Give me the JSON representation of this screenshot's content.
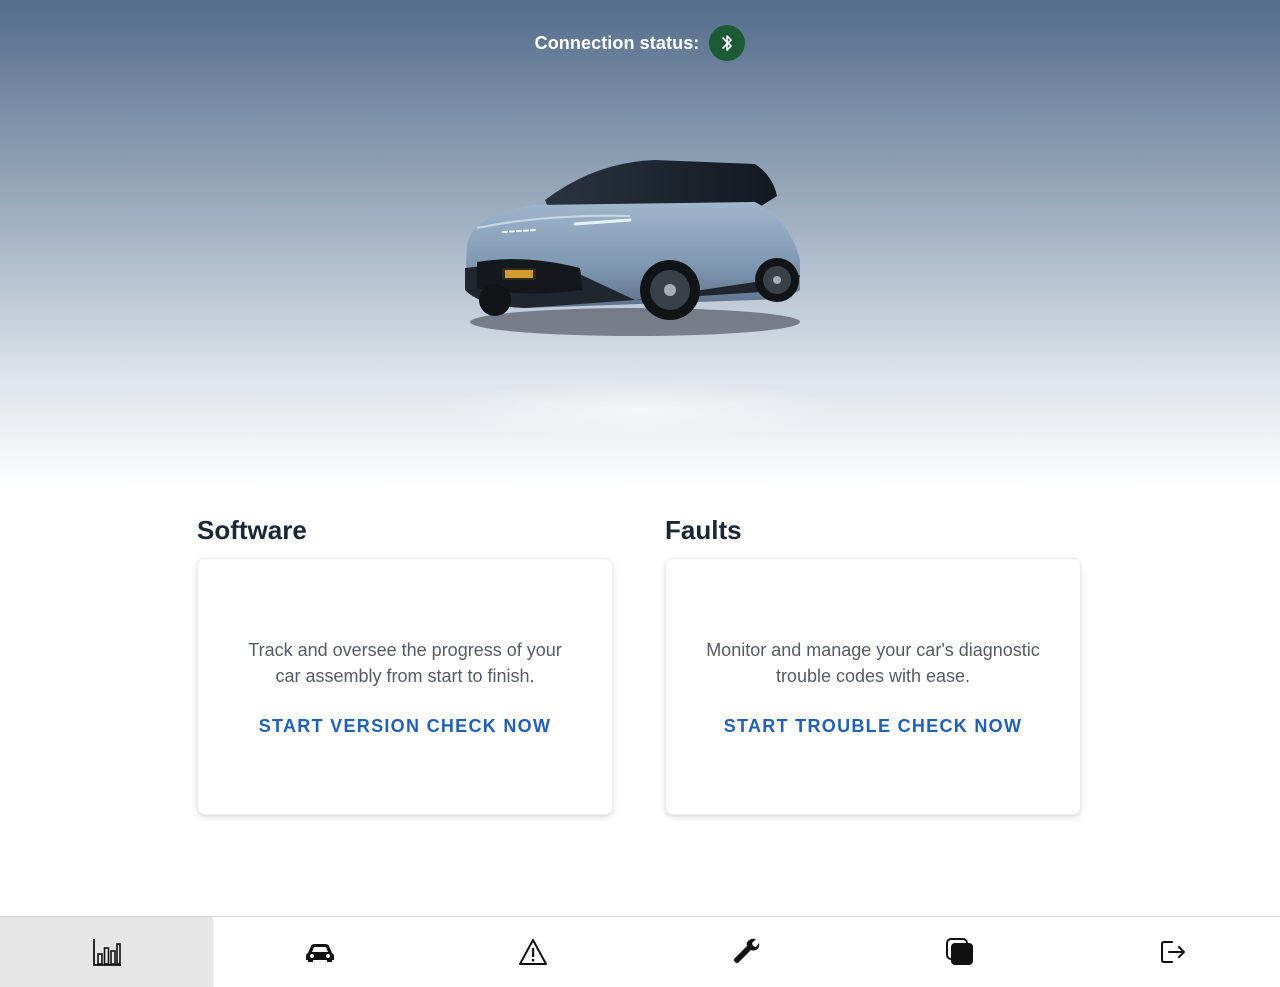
{
  "connection": {
    "label": "Connection status:",
    "state_icon": "bluetooth-icon",
    "color": "#1c5a36"
  },
  "hero": {
    "image": "vehicle-image"
  },
  "software": {
    "title": "Software",
    "description": "Track and oversee the progress of your car assembly from start to finish.",
    "action": "START VERSION CHECK NOW"
  },
  "faults": {
    "title": "Faults",
    "description": "Monitor and manage your car's diagnostic trouble codes with ease.",
    "action": "START TROUBLE CHECK NOW"
  },
  "nav": {
    "items": [
      {
        "icon": "bar-chart-icon",
        "active": true
      },
      {
        "icon": "car-icon",
        "active": false
      },
      {
        "icon": "warning-icon",
        "active": false
      },
      {
        "icon": "wrench-icon",
        "active": false
      },
      {
        "icon": "copy-icon",
        "active": false
      },
      {
        "icon": "logout-icon",
        "active": false
      }
    ]
  },
  "colors": {
    "accent": "#2160b8",
    "heading": "#1b2733",
    "nav_active_bg": "#e6e6e6"
  }
}
